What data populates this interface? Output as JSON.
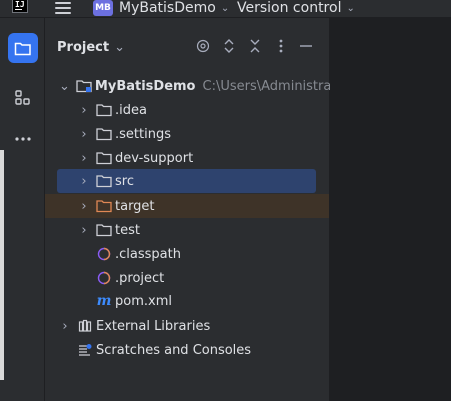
{
  "app": {
    "logo_text": "IJ",
    "project_badge": "MB",
    "project_name": "MyBatisDemo",
    "vcs_label": "Version control"
  },
  "panel": {
    "title": "Project"
  },
  "tree": {
    "root": {
      "label": "MyBatisDemo",
      "path": "C:\\Users\\Administrato"
    },
    "items": [
      {
        "label": ".idea"
      },
      {
        "label": ".settings"
      },
      {
        "label": "dev-support"
      },
      {
        "label": "src"
      },
      {
        "label": "target"
      },
      {
        "label": "test"
      },
      {
        "label": ".classpath"
      },
      {
        "label": ".project"
      },
      {
        "label": "pom.xml"
      },
      {
        "label": "External Libraries"
      },
      {
        "label": "Scratches and Consoles"
      }
    ]
  },
  "colors": {
    "accent": "#3574f0",
    "selection": "#2e436e",
    "excluded": "#3e3328",
    "excluded_folder": "#e08855",
    "maven": "#3d8bfd",
    "eclipse_file": "#8b5cf6"
  }
}
